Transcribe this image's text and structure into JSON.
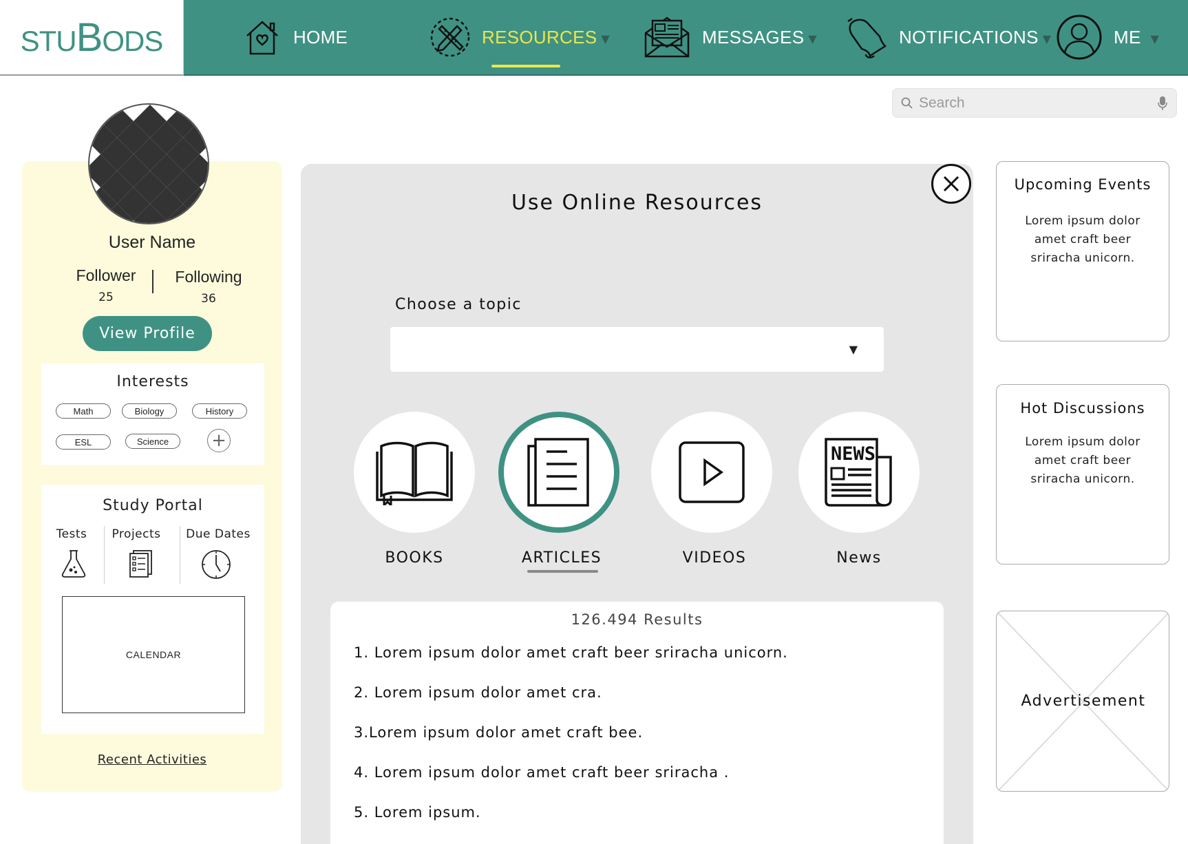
{
  "brand": {
    "logo_text_small_1": "STU",
    "logo_text_cap_1": "B",
    "logo_text_small_2": "ODS"
  },
  "nav": {
    "home": "HOME",
    "resources": "RESOURCES",
    "messages": "MESSAGES",
    "notifications": "NOTIFICATIONS",
    "me": "ME",
    "caret": "▼"
  },
  "search": {
    "placeholder": "Search"
  },
  "profile": {
    "user_name": "User Name",
    "follower_label": "Follower",
    "follower_count": "25",
    "following_label": "Following",
    "following_count": "36",
    "view_profile": "View Profile"
  },
  "interests": {
    "title": "Interests",
    "chips": [
      "Math",
      "Biology",
      "History",
      "ESL",
      "Science"
    ],
    "add": "+"
  },
  "study_portal": {
    "title": "Study Portal",
    "columns": [
      "Tests",
      "Projects",
      "Due Dates"
    ],
    "calendar": "CALENDAR"
  },
  "recent_activities": "Recent Activities",
  "resources": {
    "title": "Use Online Resources",
    "topic_label": "Choose a topic",
    "topic_caret": "▼",
    "types": [
      "BOOKS",
      "ARTICLES",
      "VIDEOS",
      "News"
    ],
    "news_icon_text": "NEWS",
    "results_count": "126.494 Results",
    "results": [
      "1. Lorem ipsum dolor amet craft beer sriracha unicorn.",
      "2. Lorem ipsum dolor amet cra.",
      "3.Lorem ipsum dolor amet craft bee.",
      "4. Lorem ipsum dolor amet craft beer sriracha .",
      "5. Lorem ipsum."
    ]
  },
  "sidebar": {
    "upcoming_title": "Upcoming Events",
    "upcoming_body_1": "Lorem ipsum dolor",
    "upcoming_body_2": "amet craft beer",
    "upcoming_body_3": "sriracha unicorn.",
    "hot_title": "Hot Discussions",
    "hot_body_1": "Lorem ipsum dolor",
    "hot_body_2": "amet craft beer",
    "hot_body_3": "sriracha unicorn.",
    "advertisement": "Advertisement"
  },
  "colors": {
    "brand": "#3f9283",
    "accent": "#ece64a",
    "profile_bg": "#fefbdc",
    "panel_bg": "#e6e6e6"
  }
}
